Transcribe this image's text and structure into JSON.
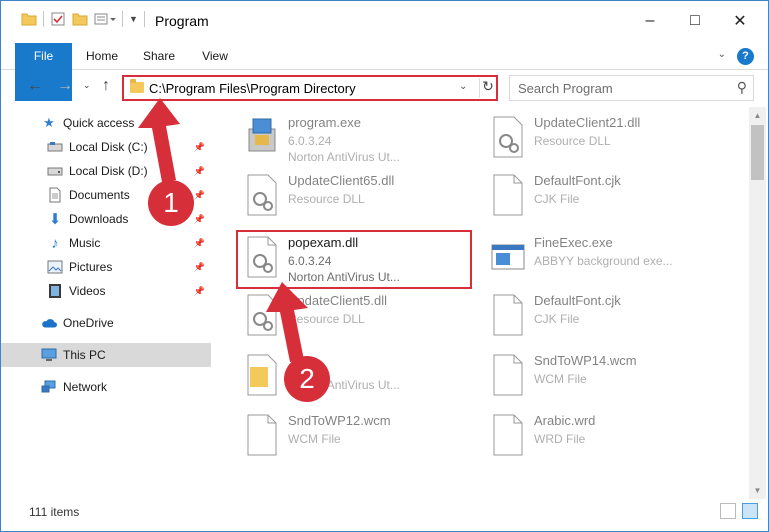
{
  "window": {
    "title": "Program",
    "controls": {
      "minimize": "–",
      "maximize": "□",
      "close": "✕"
    }
  },
  "ribbon": {
    "tabs": [
      "File",
      "Home",
      "Share",
      "View"
    ],
    "help": "?"
  },
  "address": {
    "path": "C:\\Program Files\\Program Directory",
    "search_placeholder": "Search Program"
  },
  "nav": {
    "items": [
      {
        "label": "Quick access",
        "icon": "star-icon",
        "pinned": false
      },
      {
        "label": "Local Disk (C:)",
        "icon": "drive-icon",
        "pinned": true
      },
      {
        "label": "Local Disk (D:)",
        "icon": "drive-icon",
        "pinned": true
      },
      {
        "label": "Documents",
        "icon": "documents-icon",
        "pinned": true
      },
      {
        "label": "Downloads",
        "icon": "download-icon",
        "pinned": true
      },
      {
        "label": "Music",
        "icon": "music-icon",
        "pinned": true
      },
      {
        "label": "Pictures",
        "icon": "pictures-icon",
        "pinned": true
      },
      {
        "label": "Videos",
        "icon": "videos-icon",
        "pinned": true
      },
      {
        "label": "OneDrive",
        "icon": "cloud-icon",
        "pinned": false
      },
      {
        "label": "This PC",
        "icon": "computer-icon",
        "pinned": false,
        "selected": true
      },
      {
        "label": "Network",
        "icon": "network-icon",
        "pinned": false
      }
    ]
  },
  "files": [
    {
      "name": "program.exe",
      "line2": "6.0.3.24",
      "line3": "Norton AntiVirus Ut...",
      "icon": "installer-icon"
    },
    {
      "name": "UpdateClient21.dll",
      "line2": "Resource DLL",
      "line3": "",
      "icon": "dll-icon"
    },
    {
      "name": "UpdateClient65.dll",
      "line2": "Resource DLL",
      "line3": "",
      "icon": "dll-icon"
    },
    {
      "name": "DefaultFont.cjk",
      "line2": "CJK File",
      "line3": "",
      "icon": "blank-file-icon"
    },
    {
      "name": "popexam.dll",
      "line2": "6.0.3.24",
      "line3": "Norton AntiVirus Ut...",
      "icon": "dll-icon"
    },
    {
      "name": "FineExec.exe",
      "line2": "ABBYY background exe...",
      "line3": "",
      "icon": "app-window-icon"
    },
    {
      "name": "UpdateClient5.dll",
      "line2": "Resource DLL",
      "line3": "",
      "icon": "dll-icon"
    },
    {
      "name": "DefaultFont.cjk",
      "line2": "CJK File",
      "line3": "",
      "icon": "blank-file-icon"
    },
    {
      "name": "",
      "line2": "",
      "line3": "Norton AntiVirus Ut...",
      "icon": "folder-file-icon"
    },
    {
      "name": "SndToWP14.wcm",
      "line2": "WCM File",
      "line3": "",
      "icon": "blank-file-icon"
    },
    {
      "name": "SndToWP12.wcm",
      "line2": "WCM File",
      "line3": "",
      "icon": "blank-file-icon"
    },
    {
      "name": "Arabic.wrd",
      "line2": "WRD File",
      "line3": "",
      "icon": "blank-file-icon"
    }
  ],
  "status": {
    "item_count": "111 items"
  },
  "annotations": {
    "callout_1": "1",
    "callout_2": "2"
  },
  "colors": {
    "accent": "#1979ca",
    "highlight": "#d62f3a",
    "selection": "#d9d9d9"
  }
}
